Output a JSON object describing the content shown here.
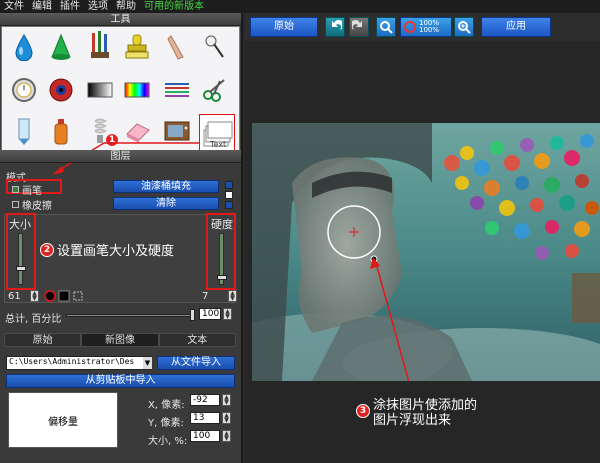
{
  "menu": {
    "items": [
      "文件",
      "编辑",
      "插件",
      "选项",
      "帮助"
    ],
    "new_version": "可用的新版本"
  },
  "tools_panel": {
    "title": "工具",
    "items": [
      "water-drop-icon",
      "cone-icon",
      "paintbrushes-icon",
      "stamp-icon",
      "finger-smudge-icon",
      "pin-icon",
      "clock-icon",
      "eye-icon",
      "gradient-icon",
      "color-bar-icon",
      "lines-icon",
      "scissors-icon",
      "tube-icon",
      "bottle-icon",
      "bulb-icon",
      "eraser-icon",
      "tv-icon",
      "text-paper-icon"
    ],
    "selected_item_label": "Text"
  },
  "layer_panel": {
    "title": "图层",
    "mode_label": "模式",
    "brush_option": "画笔",
    "eraser_option": "橡皮擦",
    "fill_button": "油漆桶填充",
    "clear_button": "清除",
    "size_label": "大小",
    "hardness_label": "硬度",
    "size_value": "61",
    "size_level": 0.3,
    "hardness_value": "7",
    "hardness_level": 0.1,
    "opacity_label": "总计, 百分比",
    "opacity_value": "100"
  },
  "annotations": {
    "one": "1",
    "two": "2",
    "two_text": "设置画笔大小及硬度",
    "three": "3",
    "three_line1": "涂抹图片使添加的",
    "three_line2": "图片浮现出来"
  },
  "tabs": [
    "原始",
    "新图像",
    "文本"
  ],
  "image_source": {
    "path": "C:\\Users\\Administrator\\Des",
    "from_file_button": "从文件导入",
    "from_clipboard_button": "从剪贴板中导入"
  },
  "offset": {
    "box_label": "偏移量",
    "x_label": "X, 像素:",
    "x_value": "-92",
    "y_label": "Y, 像素:",
    "y_value": "13",
    "size_label": "大小, %:",
    "size_value": "100"
  },
  "toolbar": {
    "original_button": "原始",
    "apply_button": "应用",
    "zoom_label": "100%"
  },
  "colors": {
    "accent_blue": "#1d56c4",
    "annotation_red": "#e01919",
    "menu_highlight": "#43d743"
  }
}
